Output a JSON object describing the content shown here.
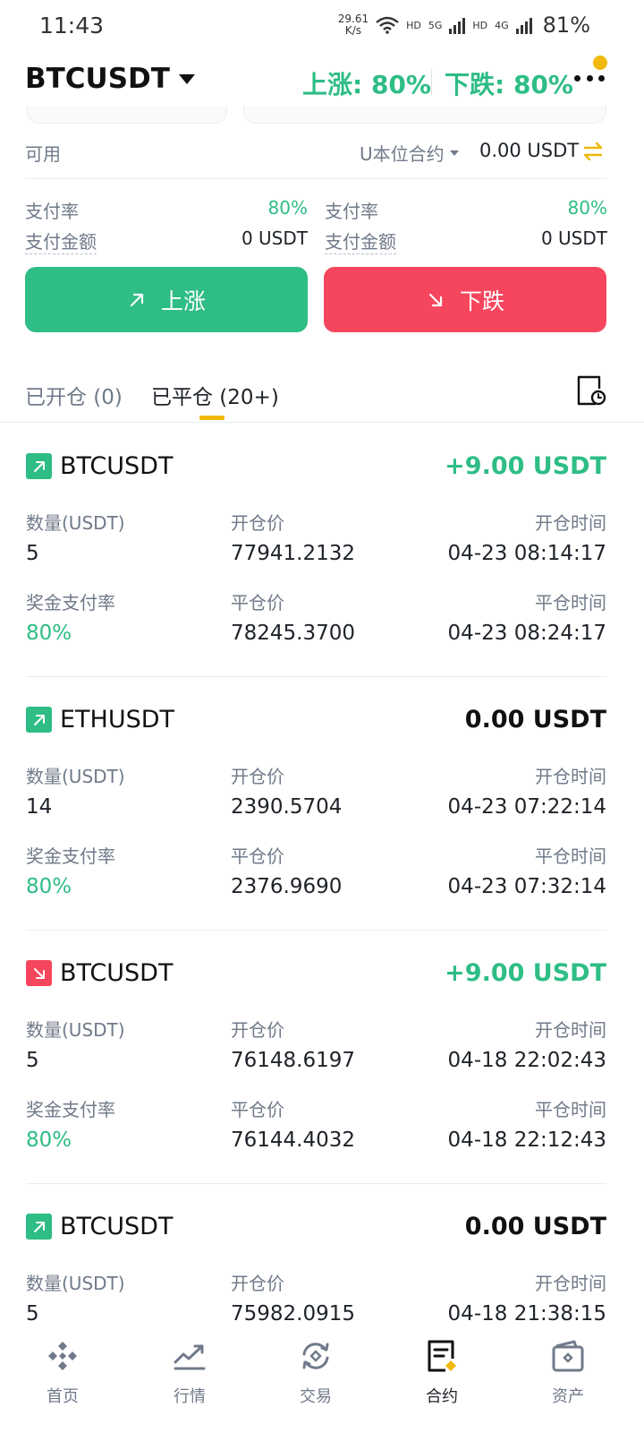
{
  "status_bar": {
    "time": "11:43",
    "net_speed_value": "29.61",
    "net_speed_unit": "K/s",
    "hd1": "HD",
    "hd2": "HD",
    "sig1_tag": "5G",
    "sig2_tag": "4G",
    "battery": "81%"
  },
  "header": {
    "pair": "BTCUSDT",
    "rise_label": "上涨: 80%",
    "fall_label": "下跌: 80%"
  },
  "balance": {
    "label": "可用",
    "contract_type": "U本位合约",
    "amount": "0.00 USDT"
  },
  "payout": {
    "left": {
      "rate_label": "支付率",
      "rate_value": "80%",
      "amount_label": "支付金额",
      "amount_value": "0 USDT"
    },
    "right": {
      "rate_label": "支付率",
      "rate_value": "80%",
      "amount_label": "支付金额",
      "amount_value": "0 USDT"
    }
  },
  "actions": {
    "rise_label": "上涨",
    "fall_label": "下跌"
  },
  "tabs": {
    "open_label": "已开仓 (0)",
    "closed_label": "已平仓 (20+)"
  },
  "labels": {
    "qty": "数量(USDT)",
    "open_price": "开仓价",
    "open_time": "开仓时间",
    "bonus_rate": "奖金支付率",
    "close_price": "平仓价",
    "close_time": "平仓时间"
  },
  "records": [
    {
      "symbol": "BTCUSDT",
      "direction": "up",
      "pnl": "+9.00 USDT",
      "pnl_style": "pos",
      "qty": "5",
      "open_price": "77941.2132",
      "open_time": "04-23 08:14:17",
      "bonus_rate": "80%",
      "close_price": "78245.3700",
      "close_time": "04-23 08:24:17"
    },
    {
      "symbol": "ETHUSDT",
      "direction": "up",
      "pnl": "0.00 USDT",
      "pnl_style": "zero",
      "qty": "14",
      "open_price": "2390.5704",
      "open_time": "04-23 07:22:14",
      "bonus_rate": "80%",
      "close_price": "2376.9690",
      "close_time": "04-23 07:32:14"
    },
    {
      "symbol": "BTCUSDT",
      "direction": "down",
      "pnl": "+9.00 USDT",
      "pnl_style": "pos",
      "qty": "5",
      "open_price": "76148.6197",
      "open_time": "04-18 22:02:43",
      "bonus_rate": "80%",
      "close_price": "76144.4032",
      "close_time": "04-18 22:12:43"
    },
    {
      "symbol": "BTCUSDT",
      "direction": "up",
      "pnl": "0.00 USDT",
      "pnl_style": "zero",
      "qty": "5",
      "open_price": "75982.0915",
      "open_time": "04-18 21:38:15",
      "bonus_rate": "",
      "close_price": "",
      "close_time": ""
    }
  ],
  "bottom_nav": [
    {
      "label": "首页",
      "icon": "home-icon"
    },
    {
      "label": "行情",
      "icon": "market-chart-icon"
    },
    {
      "label": "交易",
      "icon": "trade-icon"
    },
    {
      "label": "合约",
      "icon": "contract-icon",
      "active": true
    },
    {
      "label": "资产",
      "icon": "wallet-icon"
    }
  ],
  "colors": {
    "accent": "#f0b90b",
    "rise": "#2ebd85",
    "fall": "#f6465d",
    "text": "#1e2329",
    "muted": "#707a8a"
  }
}
